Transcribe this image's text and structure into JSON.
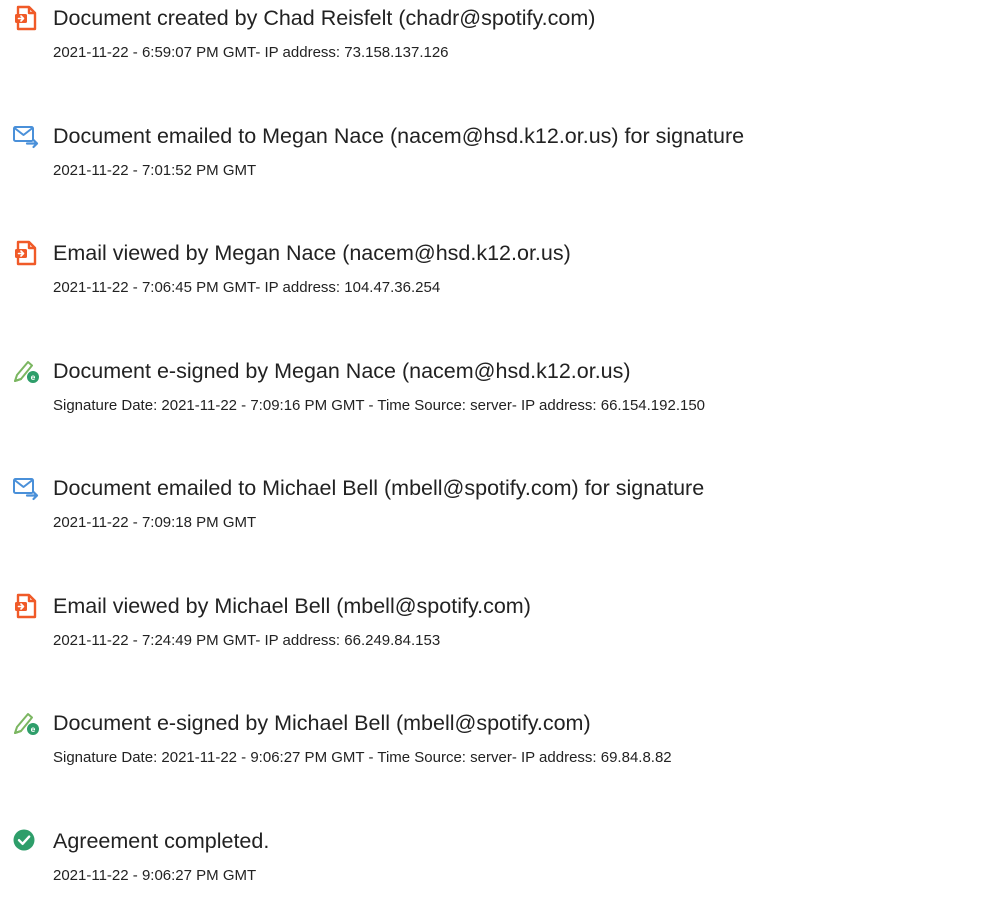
{
  "events": [
    {
      "icon": "document-created-icon",
      "title": "Document created by Chad Reisfelt (chadr@spotify.com)",
      "detail": "2021-11-22 - 6:59:07 PM GMT- IP address: 73.158.137.126"
    },
    {
      "icon": "email-sent-icon",
      "title": "Document emailed to Megan Nace (nacem@hsd.k12.or.us) for signature",
      "detail": "2021-11-22 - 7:01:52 PM GMT"
    },
    {
      "icon": "document-viewed-icon",
      "title": "Email viewed by Megan Nace (nacem@hsd.k12.or.us)",
      "detail": "2021-11-22 - 7:06:45 PM GMT- IP address: 104.47.36.254"
    },
    {
      "icon": "e-signed-icon",
      "title": "Document e-signed by Megan Nace (nacem@hsd.k12.or.us)",
      "detail": "Signature Date: 2021-11-22 - 7:09:16 PM GMT - Time Source: server- IP address: 66.154.192.150"
    },
    {
      "icon": "email-sent-icon",
      "title": "Document emailed to Michael Bell (mbell@spotify.com) for signature",
      "detail": "2021-11-22 - 7:09:18 PM GMT"
    },
    {
      "icon": "document-viewed-icon",
      "title": "Email viewed by Michael Bell (mbell@spotify.com)",
      "detail": "2021-11-22 - 7:24:49 PM GMT- IP address: 66.249.84.153"
    },
    {
      "icon": "e-signed-icon",
      "title": "Document e-signed by Michael Bell (mbell@spotify.com)",
      "detail": "Signature Date: 2021-11-22 - 9:06:27 PM GMT - Time Source: server- IP address: 69.84.8.82"
    },
    {
      "icon": "agreement-completed-icon",
      "title": "Agreement completed.",
      "detail": "2021-11-22 - 9:06:27 PM GMT"
    }
  ],
  "colors": {
    "document_icon": "#f05a28",
    "email_icon": "#4a90d9",
    "signed_icon_pen": "#7bb661",
    "signed_icon_badge": "#2e9e6a",
    "completed_icon": "#2e9e6a",
    "text": "#222222"
  }
}
